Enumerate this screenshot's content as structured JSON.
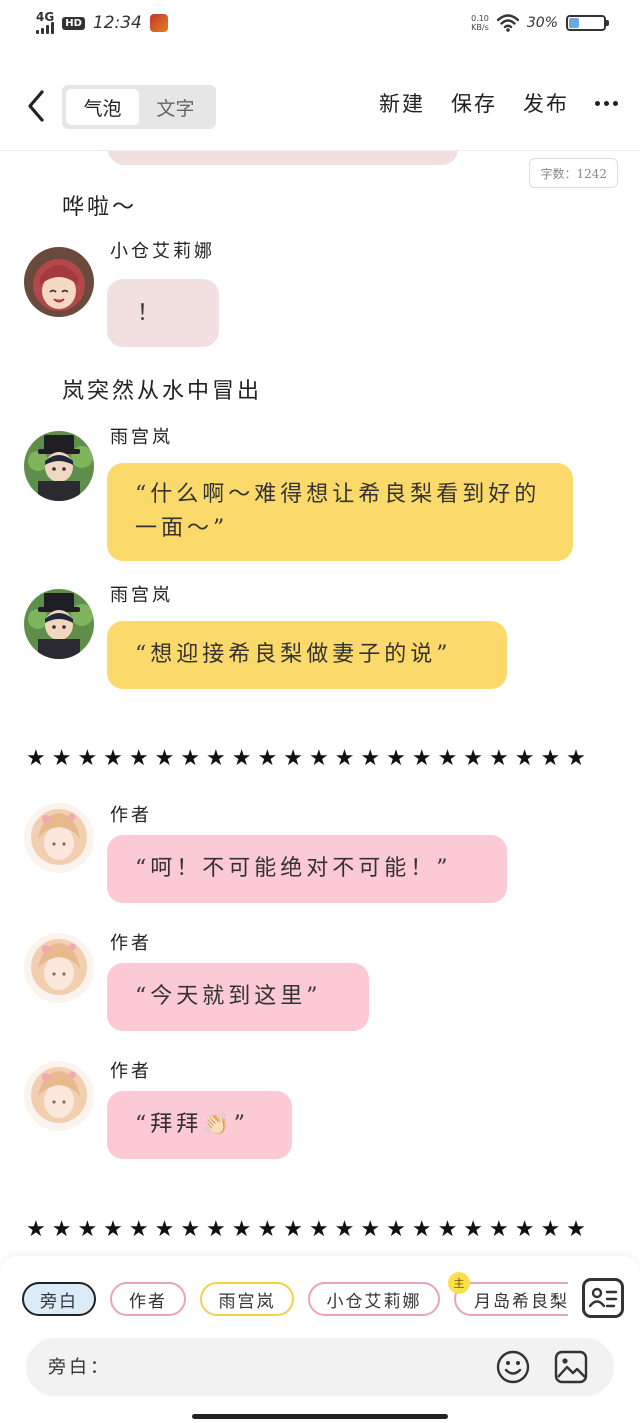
{
  "status_bar": {
    "network": "4G",
    "hd": "HD",
    "time": "12:34",
    "speed_value": "0.10",
    "speed_unit": "KB/s",
    "battery_percent": "30%",
    "battery_level": 0.3
  },
  "header": {
    "tabs": [
      {
        "label": "气泡",
        "active": true
      },
      {
        "label": "文字",
        "active": false
      }
    ],
    "actions": {
      "new": "新建",
      "save": "保存",
      "publish": "发布"
    }
  },
  "word_count": "字数：1242",
  "story": {
    "narration_1": "哗啦～",
    "narration_2": "岚突然从水中冒出",
    "messages": [
      {
        "speaker": "小仓艾莉娜",
        "text": "！"
      },
      {
        "speaker": "雨宫岚",
        "text": "“什么啊～难得想让希良梨看到好的一面～”"
      },
      {
        "speaker": "雨宫岚",
        "text": "“想迎接希良梨做妻子的说”"
      },
      {
        "speaker": "作者",
        "text": "“呵！不可能绝对不可能！”"
      },
      {
        "speaker": "作者",
        "text": "“今天就到这里”"
      },
      {
        "speaker": "作者",
        "text": "“拜拜👏🏻”"
      }
    ],
    "separator": "★★★★★★★★★★★★★★★★★★★★★★"
  },
  "composer": {
    "roles": [
      "旁白",
      "作者",
      "雨宫岚",
      "小仓艾莉娜",
      "月岛希良梨"
    ],
    "main_badge": "主",
    "input_label": "旁白：",
    "input_value": ""
  },
  "colors": {
    "bubble_yellow": "#fbd96a",
    "bubble_pink": "#fbcad4",
    "bubble_pink_light": "#f2dfe0",
    "active_chip": "#dcebf8"
  }
}
